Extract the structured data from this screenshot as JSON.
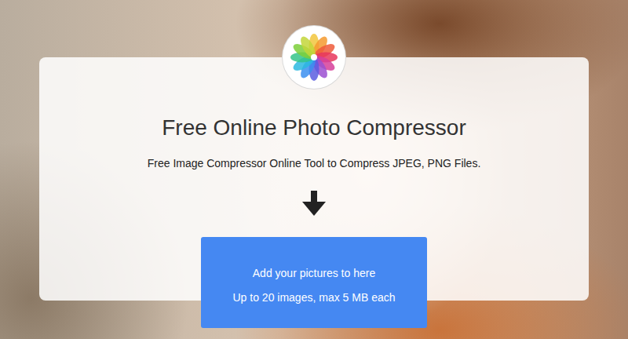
{
  "page": {
    "title": "Free Online Photo Compressor",
    "subtitle": "Free Image Compressor Online Tool to Compress JPEG, PNG Files."
  },
  "upload": {
    "label": "Add your pictures to here",
    "limits": "Up to 20 images, max 5 MB each"
  }
}
